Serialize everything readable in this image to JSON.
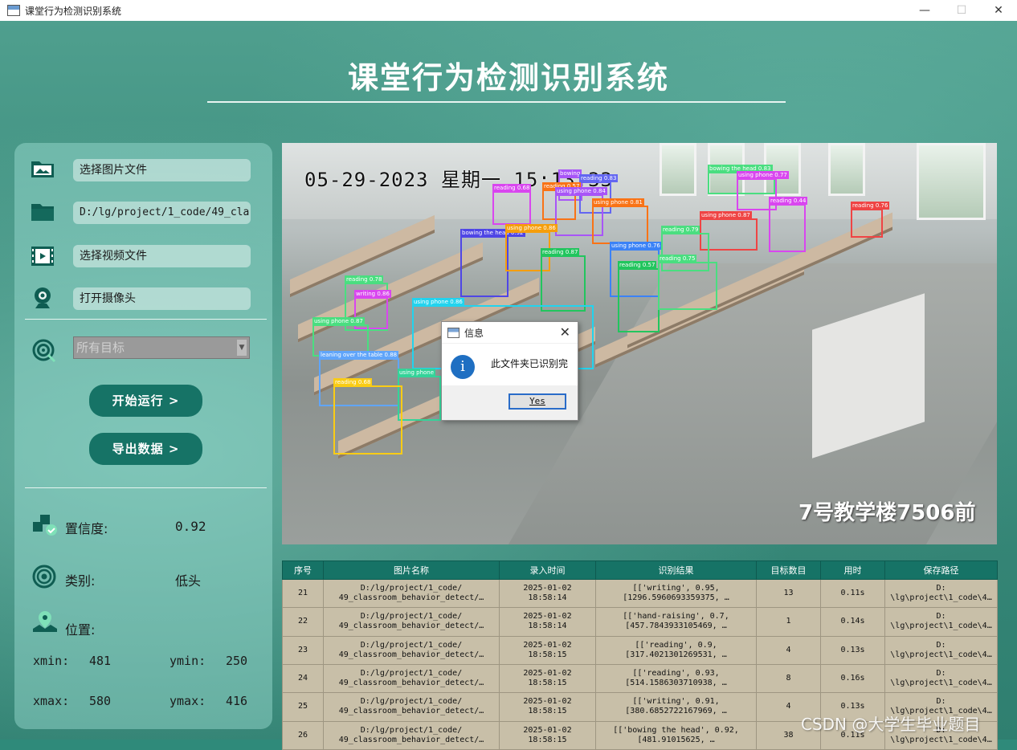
{
  "window": {
    "title": "课堂行为检测识别系统",
    "minimize": "—",
    "maximize": "☐",
    "close": "✕"
  },
  "app_title": "课堂行为检测识别系统",
  "left": {
    "select_image": "选择图片文件",
    "folder_path": "D:/lg/project/1_code/49_cla",
    "select_video": "选择视频文件",
    "open_camera": "打开摄像头",
    "target_combo": "所有目标",
    "start_btn": "开始运行 >",
    "export_btn": "导出数据 >",
    "confidence_label": "置信度:",
    "confidence_value": "0.92",
    "class_label": "类别:",
    "class_value": "低头",
    "position_label": "位置:",
    "xmin_label": "xmin:",
    "xmin": "481",
    "ymin_label": "ymin:",
    "ymin": "250",
    "xmax_label": "xmax:",
    "xmax": "580",
    "ymax_label": "ymax:",
    "ymax": "416"
  },
  "video": {
    "timestamp": "05-29-2023 星期一 15:13:33",
    "location": "7号教学楼7506前",
    "detections": [
      {
        "label": "reading 0.68",
        "color": "#d946ef"
      },
      {
        "label": "bowing",
        "color": "#a855f7"
      },
      {
        "label": "reading 0.83",
        "color": "#6366f1"
      },
      {
        "label": "reading 0.57",
        "color": "#f97316"
      },
      {
        "label": "using phone 0.84",
        "color": "#a855f7"
      },
      {
        "label": "bowing the head 0.83",
        "color": "#4ade80"
      },
      {
        "label": "using phone 0.77",
        "color": "#d946ef"
      },
      {
        "label": "reading 0.44",
        "color": "#d946ef"
      },
      {
        "label": "reading 0.76",
        "color": "#ef4444"
      },
      {
        "label": "using phone 0.81",
        "color": "#f97316"
      },
      {
        "label": "using phone 0.87",
        "color": "#ef4444"
      },
      {
        "label": "bowing the head 0.92",
        "color": "#4f46e5"
      },
      {
        "label": "using phone 0.86",
        "color": "#f59e0b"
      },
      {
        "label": "reading 0.87",
        "color": "#22c55e"
      },
      {
        "label": "using phone 0.76",
        "color": "#3b82f6"
      },
      {
        "label": "reading 0.79",
        "color": "#4ade80"
      },
      {
        "label": "reading 0.57",
        "color": "#22c55e"
      },
      {
        "label": "reading 0.75",
        "color": "#4ade80"
      },
      {
        "label": "reading 0.78",
        "color": "#4ade80"
      },
      {
        "label": "writing 0.86",
        "color": "#d946ef"
      },
      {
        "label": "using phone 0.86",
        "color": "#22d3ee"
      },
      {
        "label": "using phone 0.87",
        "color": "#4ade80"
      },
      {
        "label": "leaning over the table 0.88",
        "color": "#60a5fa"
      },
      {
        "label": "using phone",
        "color": "#34d399"
      },
      {
        "label": "reading 0.68",
        "color": "#facc15"
      }
    ]
  },
  "dialog": {
    "title": "信息",
    "message": "此文件夹已识别完",
    "yes": "Yes"
  },
  "table": {
    "headers": [
      "序号",
      "图片名称",
      "录入时间",
      "识别结果",
      "目标数目",
      "用时",
      "保存路径"
    ],
    "rows": [
      [
        "21",
        "D:/lg/project/1_code/\n49_classroom_behavior_detect/…",
        "2025-01-02\n18:58:14",
        "[['writing', 0.95,\n[1296.5960693359375, …",
        "13",
        "0.11s",
        "D:\n\\lg\\project\\1_code\\4…"
      ],
      [
        "22",
        "D:/lg/project/1_code/\n49_classroom_behavior_detect/…",
        "2025-01-02\n18:58:14",
        "[['hand-raising', 0.7,\n[457.7843933105469, …",
        "1",
        "0.14s",
        "D:\n\\lg\\project\\1_code\\4…"
      ],
      [
        "23",
        "D:/lg/project/1_code/\n49_classroom_behavior_detect/…",
        "2025-01-02\n18:58:15",
        "[['reading', 0.9,\n[317.4021301269531, …",
        "4",
        "0.13s",
        "D:\n\\lg\\project\\1_code\\4…"
      ],
      [
        "24",
        "D:/lg/project/1_code/\n49_classroom_behavior_detect/…",
        "2025-01-02\n18:58:15",
        "[['reading', 0.93,\n[514.1586303710938, …",
        "8",
        "0.16s",
        "D:\n\\lg\\project\\1_code\\4…"
      ],
      [
        "25",
        "D:/lg/project/1_code/\n49_classroom_behavior_detect/…",
        "2025-01-02\n18:58:15",
        "[['writing', 0.91,\n[380.6852722167969, …",
        "4",
        "0.13s",
        "D:\n\\lg\\project\\1_code\\4…"
      ],
      [
        "26",
        "D:/lg/project/1_code/\n49_classroom_behavior_detect/…",
        "2025-01-02\n18:58:15",
        "[['bowing the head', 0.92,\n[481.91015625, …",
        "38",
        "0.11s",
        "D:\n\\lg\\project\\1_code\\4…"
      ]
    ]
  },
  "watermark": "CSDN @大学生毕业题目"
}
